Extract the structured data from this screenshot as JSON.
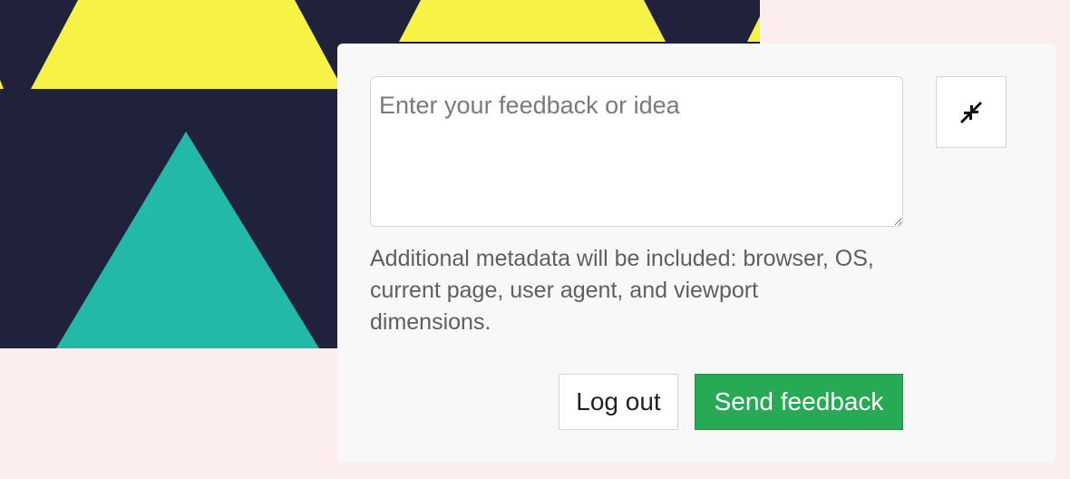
{
  "background": {
    "colors": {
      "page": "#fdeeee",
      "navy": "#20213a",
      "yellow": "#f7f246",
      "teal": "#22b9a8"
    }
  },
  "feedback": {
    "textarea": {
      "placeholder": "Enter your feedback or idea",
      "value": ""
    },
    "collapse_icon": "collapse-arrows-icon",
    "metadata_note": "Additional metadata will be included: browser, OS, current page, user agent, and viewport dimensions.",
    "buttons": {
      "logout_label": "Log out",
      "send_label": "Send feedback"
    },
    "colors": {
      "panel": "#f8f8f8",
      "send_button": "#28a956",
      "note_text": "#5f5f5f"
    }
  }
}
